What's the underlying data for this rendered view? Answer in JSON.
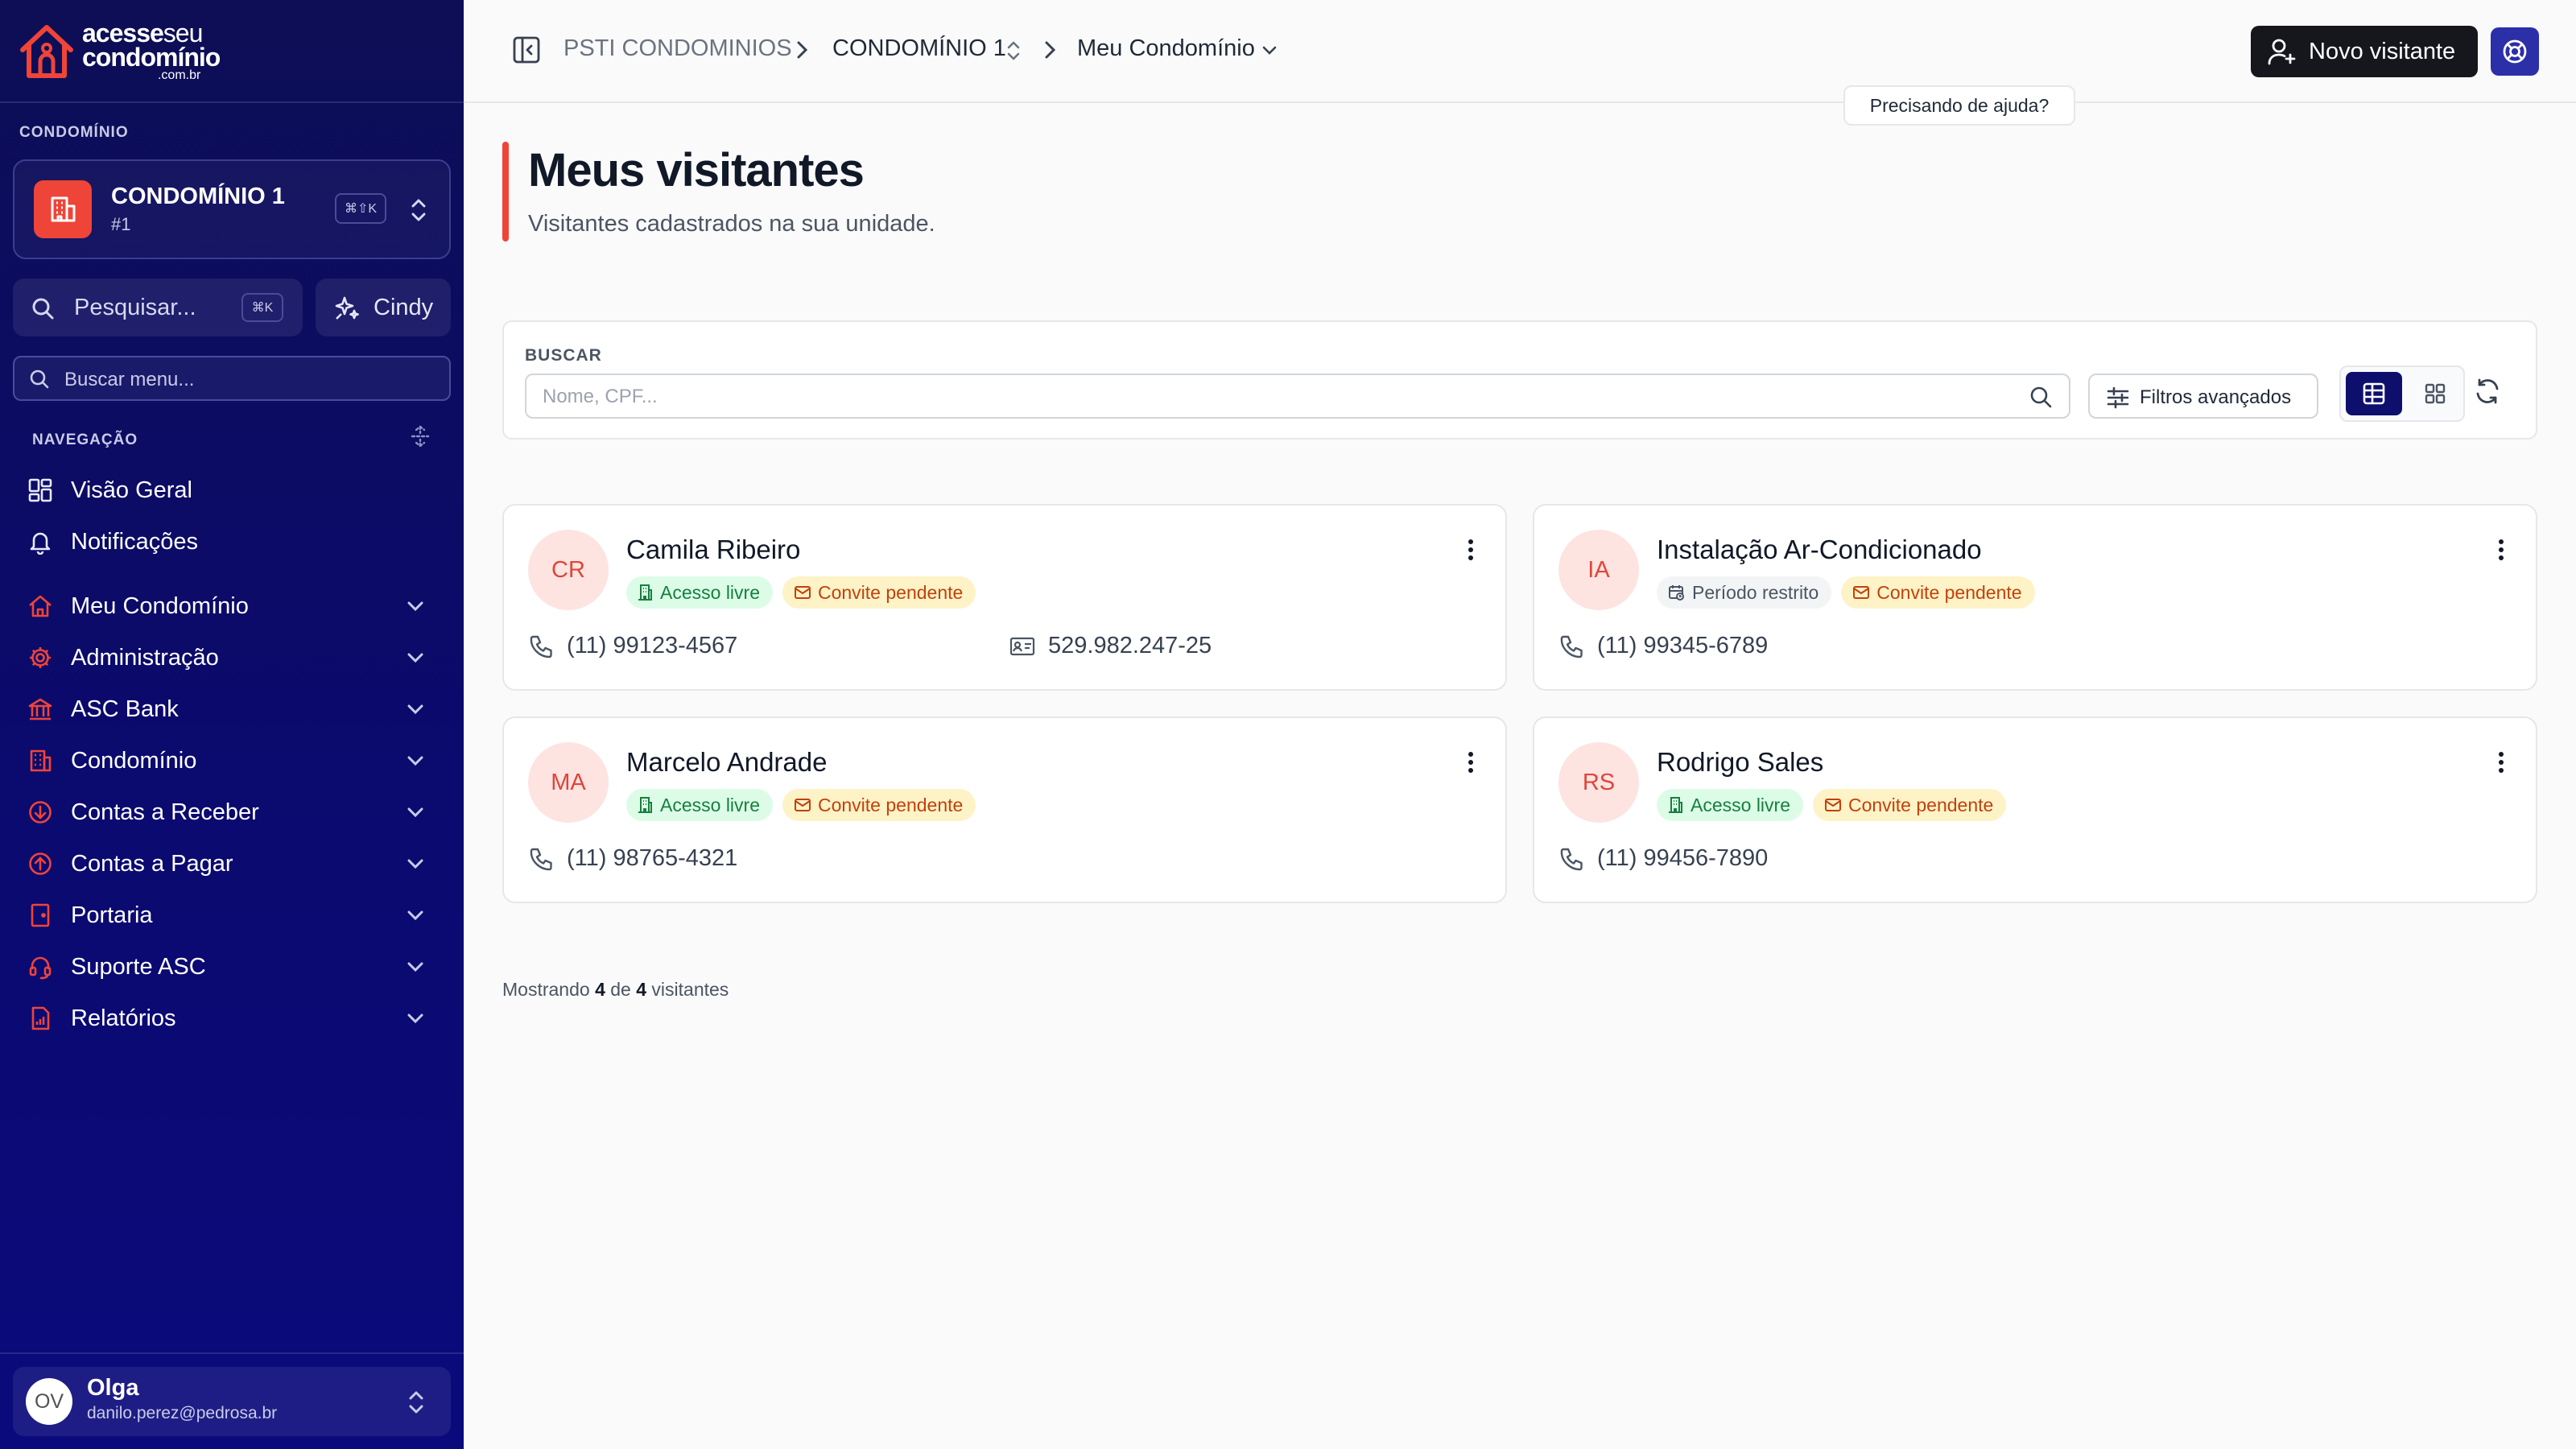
{
  "sidebar": {
    "logo": {
      "line1_bold": "acesse",
      "line1_thin": "seu",
      "line2": "condomínio",
      "line3": ".com.br"
    },
    "section_condo_label": "CONDOMÍNIO",
    "condo": {
      "name": "CONDOMÍNIO 1",
      "number": "#1",
      "shortcut": "⌘⇧K"
    },
    "search": {
      "label": "Pesquisar...",
      "shortcut": "⌘K"
    },
    "assistant_label": "Cindy",
    "menu_search_placeholder": "Buscar menu...",
    "nav_section_label": "NAVEGAÇÃO",
    "items": [
      {
        "label": "Visão Geral",
        "icon": "grid-icon"
      },
      {
        "label": "Notificações",
        "icon": "bell-icon"
      },
      {
        "label": "Meu Condomínio",
        "icon": "home-icon"
      },
      {
        "label": "Administração",
        "icon": "gear-icon"
      },
      {
        "label": "ASC Bank",
        "icon": "bank-icon"
      },
      {
        "label": "Condomínio",
        "icon": "building-icon"
      },
      {
        "label": "Contas a Receber",
        "icon": "arrow-down-circle-icon"
      },
      {
        "label": "Contas a Pagar",
        "icon": "arrow-up-circle-icon"
      },
      {
        "label": "Portaria",
        "icon": "door-icon"
      },
      {
        "label": "Suporte ASC",
        "icon": "headset-icon"
      },
      {
        "label": "Relatórios",
        "icon": "report-icon"
      }
    ],
    "user": {
      "initials": "OV",
      "name": "Olga",
      "email": "danilo.perez@pedrosa.br"
    }
  },
  "topbar": {
    "breadcrumb": [
      "PSTI CONDOMINIOS",
      "CONDOMÍNIO 1",
      "Meu Condomínio"
    ],
    "new_visitor_label": "Novo visitante",
    "help_tooltip": "Precisando de ajuda?"
  },
  "page": {
    "title": "Meus visitantes",
    "subtitle": "Visitantes cadastrados na sua unidade."
  },
  "search": {
    "label": "BUSCAR",
    "placeholder": "Nome, CPF...",
    "filters_label": "Filtros avançados"
  },
  "visitors": [
    {
      "initials": "CR",
      "name": "Camila Ribeiro",
      "access": "Acesso livre",
      "access_type": "green",
      "invite": "Convite pendente",
      "phone": "(11) 99123-4567",
      "document": "529.982.247-25"
    },
    {
      "initials": "IA",
      "name": "Instalação Ar-Condicionado",
      "access": "Período restrito",
      "access_type": "gray",
      "invite": "Convite pendente",
      "phone": "(11) 99345-6789",
      "document": ""
    },
    {
      "initials": "MA",
      "name": "Marcelo Andrade",
      "access": "Acesso livre",
      "access_type": "green",
      "invite": "Convite pendente",
      "phone": "(11) 98765-4321",
      "document": ""
    },
    {
      "initials": "RS",
      "name": "Rodrigo Sales",
      "access": "Acesso livre",
      "access_type": "green",
      "invite": "Convite pendente",
      "phone": "(11) 99456-7890",
      "document": ""
    }
  ],
  "footer": {
    "prefix": "Mostrando",
    "shown": "4",
    "middle": "de",
    "total": "4",
    "suffix": "visitantes"
  },
  "colors": {
    "sidebar_bg": "#0b0a6f",
    "accent_red": "#ef4438",
    "primary_dark": "#16161d",
    "help_blue": "#2b2fa8"
  }
}
